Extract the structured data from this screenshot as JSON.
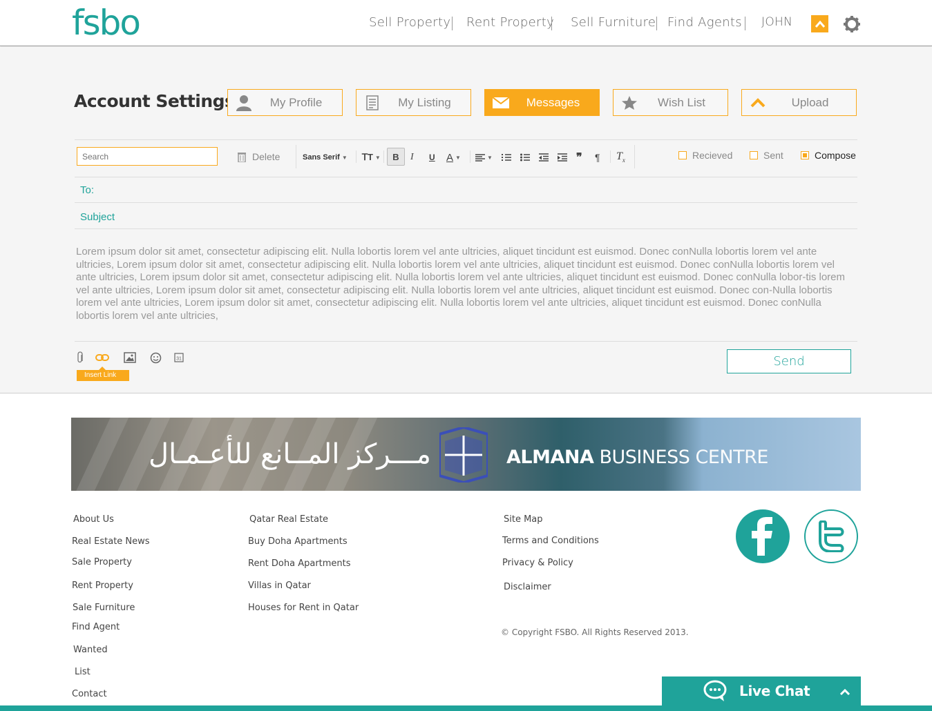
{
  "header": {
    "logo": "fsbo",
    "nav": [
      "Sell Property",
      "Rent Property",
      "Sell Furniture",
      "Find Agents"
    ],
    "user": "JOHN"
  },
  "account": {
    "title": "Account Settings",
    "tabs": [
      {
        "label": "My Profile",
        "icon": "user-icon"
      },
      {
        "label": "My Listing",
        "icon": "list-icon"
      },
      {
        "label": "Messages",
        "icon": "envelope-icon",
        "active": true
      },
      {
        "label": "Wish List",
        "icon": "star-icon"
      },
      {
        "label": "Upload",
        "icon": "upload-icon"
      }
    ]
  },
  "toolbar": {
    "search_placeholder": "Search",
    "delete_label": "Delete",
    "font_family": "Sans Serif"
  },
  "filters": {
    "received": "Recieved",
    "sent": "Sent",
    "compose": "Compose",
    "selected": "compose"
  },
  "compose": {
    "to_label": "To:",
    "subject_label": "Subject",
    "body": "Lorem ipsum dolor sit amet, consectetur adipiscing elit. Nulla lobortis lorem vel ante ultricies, aliquet tincidunt est euismod. Donec conNulla lobortis lorem vel ante ultricies,     Lorem ipsum dolor sit amet, consectetur adipiscing elit. Nulla lobortis lorem vel ante ultricies, aliquet tincidunt est euismod. Donec conNulla lobortis lorem vel ante ultricies,     Lorem ipsum dolor sit amet, consectetur adipiscing elit. Nulla lobortis lorem vel ante ultricies, aliquet tincidunt est euismod. Donec conNulla lobor-tis lorem vel ante ultricies,     Lorem ipsum dolor sit amet, consectetur adipiscing elit. Nulla lobortis lorem vel ante ultricies, aliquet tincidunt est euismod. Donec con-Nulla lobortis lorem vel ante ultricies,     Lorem ipsum dolor sit amet, consectetur adipiscing elit. Nulla lobortis lorem vel ante ultricies, aliquet tincidunt est euismod. Donec conNulla lobortis lorem vel ante ultricies,",
    "insert_link_tooltip": "Insert Link",
    "send_label": "Send"
  },
  "banner": {
    "arabic_text": "مـــركز المــانع للأعـمـال",
    "brand_bold": "ALMANA",
    "brand_rest": "BUSINESS",
    "brand_thin": "CENTRE"
  },
  "footer": {
    "col1": [
      "About Us",
      "Real Estate News",
      "Sale Property",
      "Rent Property",
      "Sale Furniture",
      "Find Agent",
      "Wanted",
      "List",
      "Contact"
    ],
    "col2": [
      "Qatar Real Estate",
      "Buy Doha Apartments",
      "Rent Doha Apartments",
      "Villas in Qatar",
      "Houses for Rent in Qatar"
    ],
    "col3": [
      "Site Map",
      "Terms and Conditions",
      "Privacy & Policy",
      "Disclaimer"
    ],
    "copyright": "© Copyright FSBO. All Rights Reserved 2013.",
    "live_chat": "Live Chat"
  },
  "colors": {
    "brand_teal": "#1fa39a",
    "accent_orange": "#f9a91c"
  }
}
